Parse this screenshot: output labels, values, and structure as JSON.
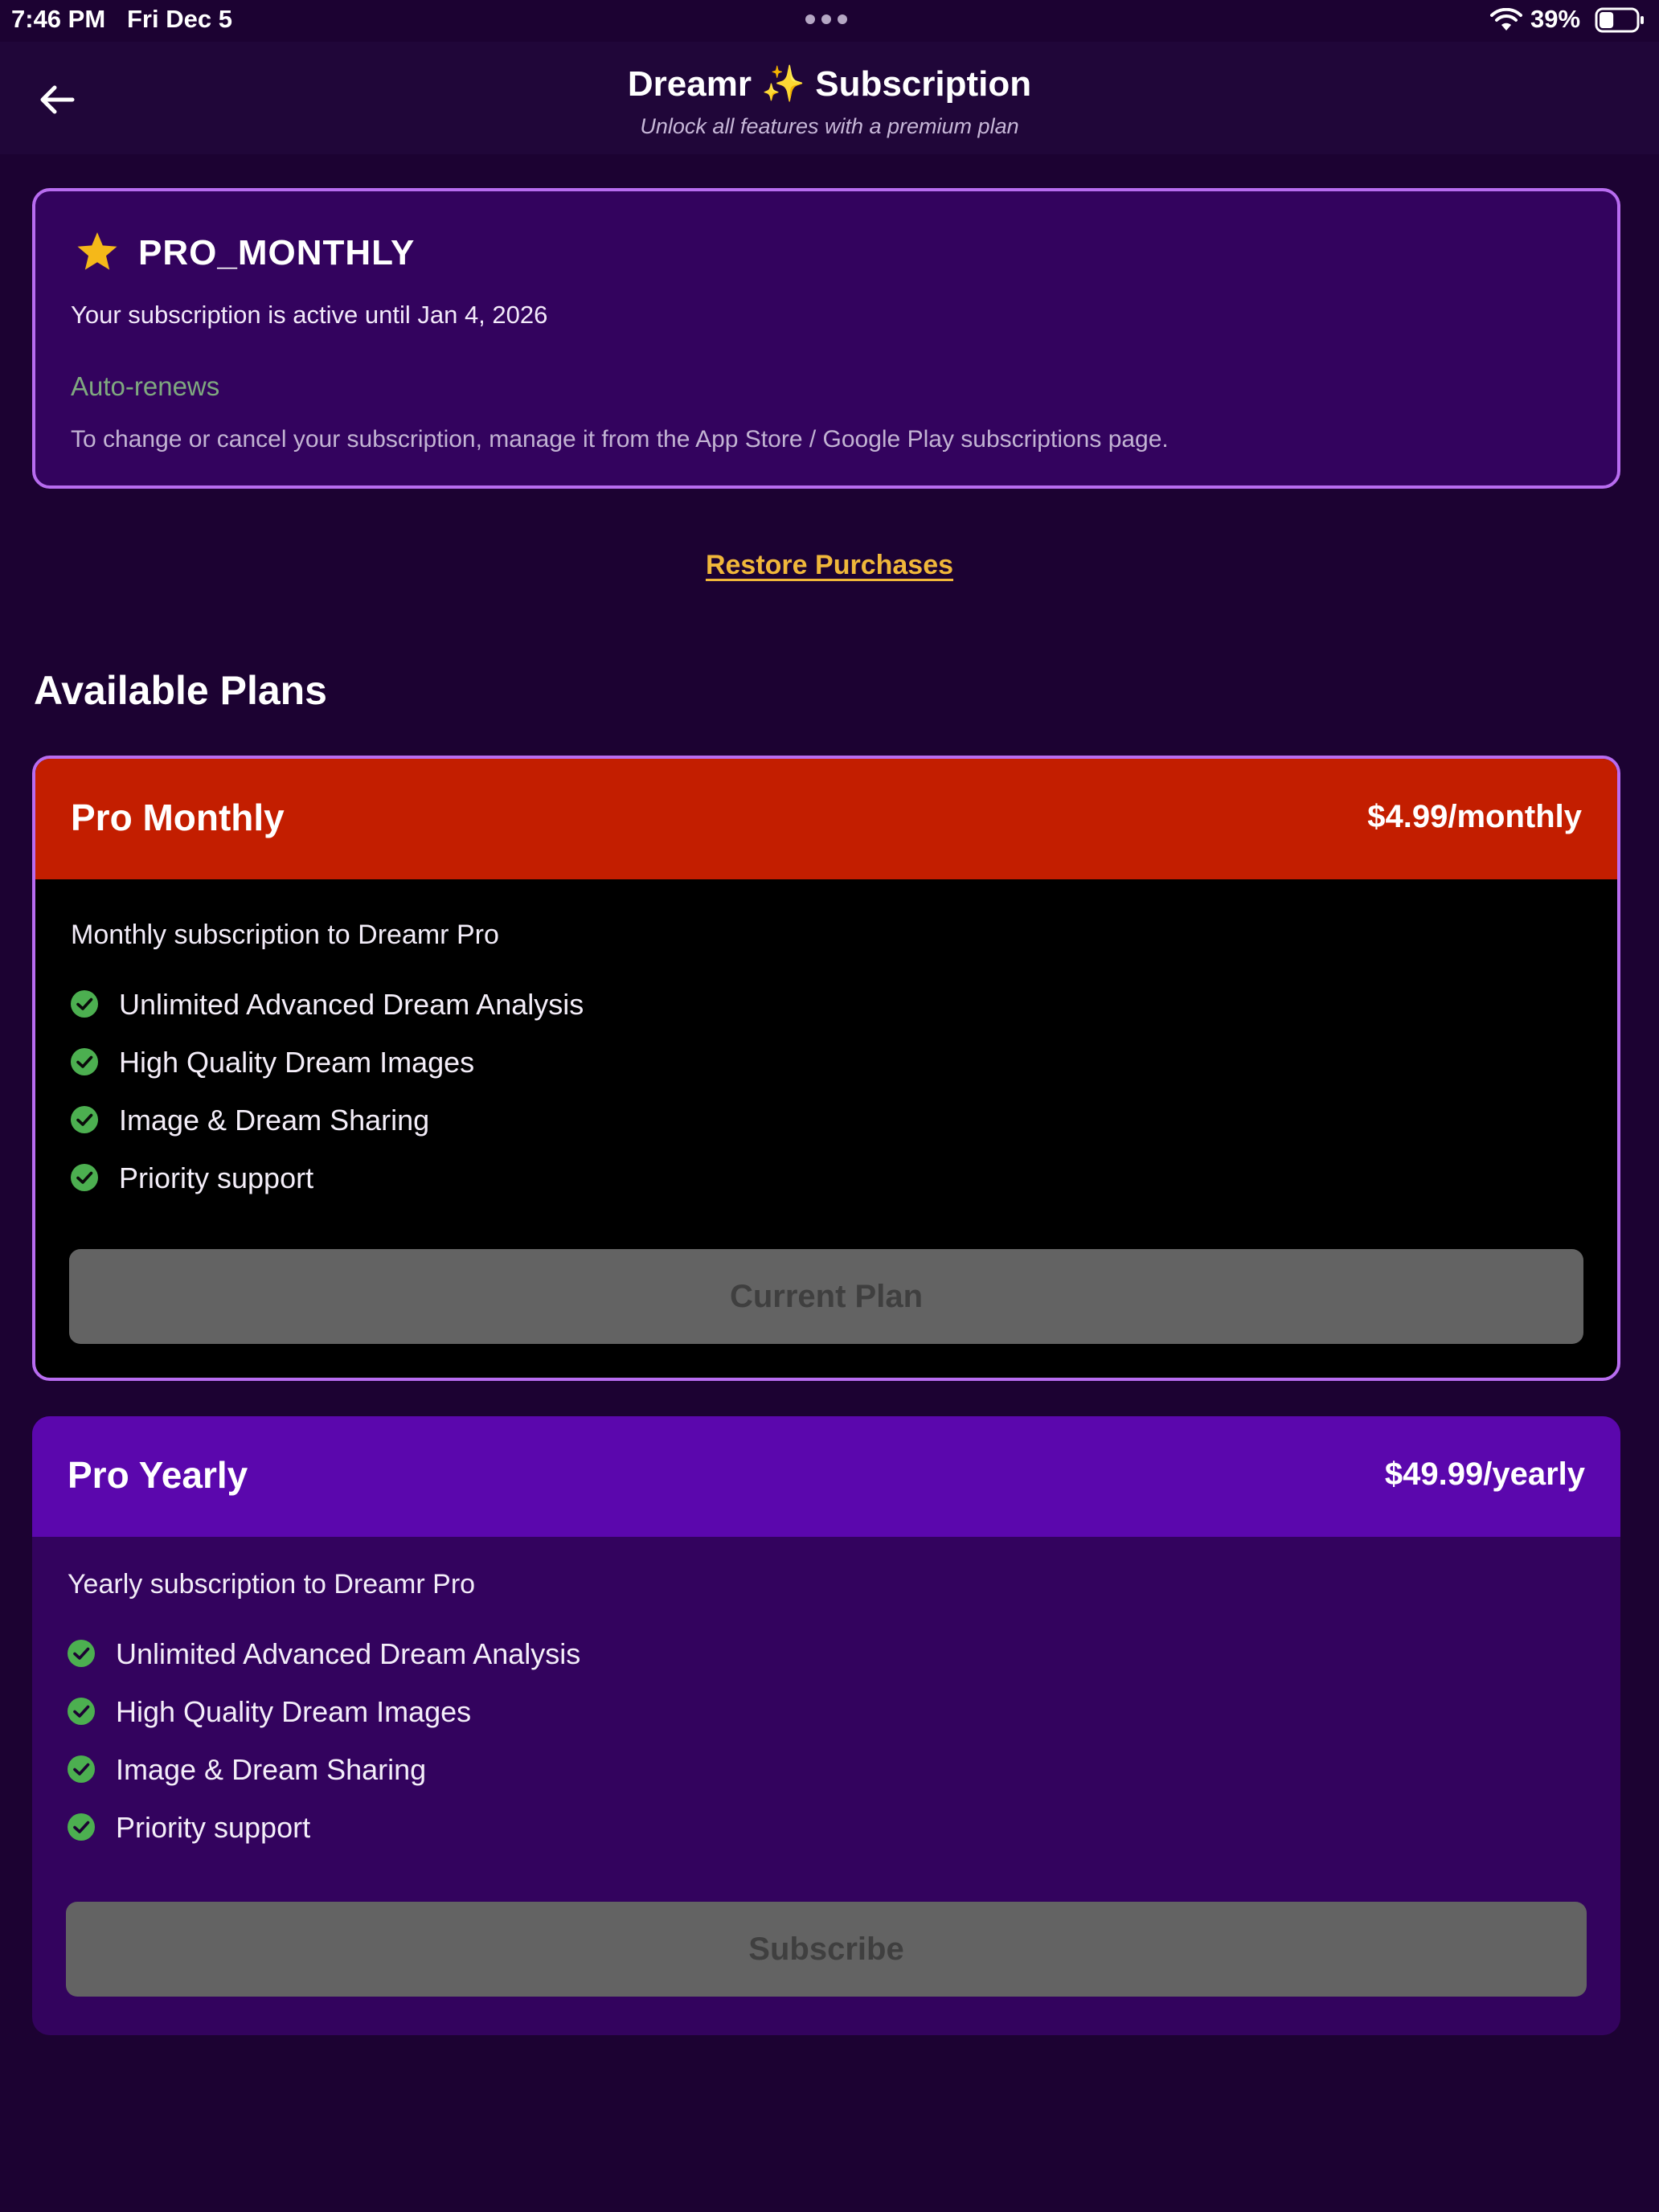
{
  "status_bar": {
    "time": "7:46 PM",
    "date": "Fri Dec 5",
    "battery_percent": "39%",
    "battery_level": 0.39
  },
  "header": {
    "title_prefix": "Dreamr",
    "title_sparkle": "✨",
    "title_suffix": "Subscription",
    "subtitle": "Unlock all features with a premium plan"
  },
  "active_subscription": {
    "plan_code": "PRO_MONTHLY",
    "status_text": "Your subscription is active until Jan 4, 2026",
    "renewal_text": "Auto-renews",
    "manage_note": "To change or cancel your subscription, manage it from the App Store / Google Play subscriptions page."
  },
  "restore_label": "Restore Purchases",
  "section_title": "Available Plans",
  "plans": [
    {
      "name": "Pro Monthly",
      "price": "$4.99/monthly",
      "description": "Monthly subscription to Dreamr Pro",
      "features": [
        "Unlimited Advanced Dream Analysis",
        "High Quality Dream Images",
        "Image & Dream Sharing",
        "Priority support"
      ],
      "button_label": "Current Plan",
      "header_color": "#c31e00"
    },
    {
      "name": "Pro Yearly",
      "price": "$49.99/yearly",
      "description": "Yearly subscription to Dreamr Pro",
      "features": [
        "Unlimited Advanced Dream Analysis",
        "High Quality Dream Images",
        "Image & Dream Sharing",
        "Priority support"
      ],
      "button_label": "Subscribe",
      "header_color": "#5b07ad"
    }
  ],
  "colors": {
    "background": "#1c0232",
    "accent_border": "#b86cf0",
    "restore_link": "#f0b73a",
    "check": "#4caf50",
    "auto_renew": "#7fa97f"
  }
}
